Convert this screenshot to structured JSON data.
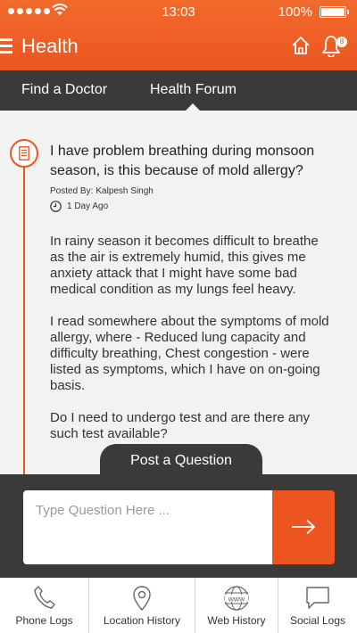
{
  "status_bar": {
    "time": "13:03",
    "battery": "100%"
  },
  "header": {
    "title": "Health",
    "notification_count": "8"
  },
  "tabs": [
    {
      "label": "Find a Doctor"
    },
    {
      "label": "Health Forum"
    }
  ],
  "post": {
    "title": "I have problem breathing during  monsoon season, is this because of mold allergy?",
    "posted_by_label": "Posted By:",
    "author": "Kalpesh Singh",
    "time_ago": "1 Day Ago",
    "paragraphs": [
      "In rainy season it becomes difficult to breathe as the air is extremely humid, this gives me anxiety attack that I might have some bad medical condition as my lungs feel heavy.",
      "I read somewhere about the symptoms of mold allergy, where - Reduced lung capacity and difficulty breathing, Chest congestion - were listed as symptoms, which I have on on-going basis.",
      "Do I need to undergo test and are there any such test available?"
    ]
  },
  "compose": {
    "post_label": "Post a Question",
    "placeholder": "Type Question Here ..."
  },
  "bottom_nav": [
    {
      "label": "Phone Logs",
      "icon": "phone-icon"
    },
    {
      "label": "Location History",
      "icon": "location-pin-icon"
    },
    {
      "label": "Web History",
      "icon": "www-globe-icon"
    },
    {
      "label": "Social Logs",
      "icon": "chat-bubble-icon"
    }
  ],
  "colors": {
    "accent": "#ec5520",
    "dark": "#3a3a3a",
    "content_bg": "#f2f2f2"
  }
}
